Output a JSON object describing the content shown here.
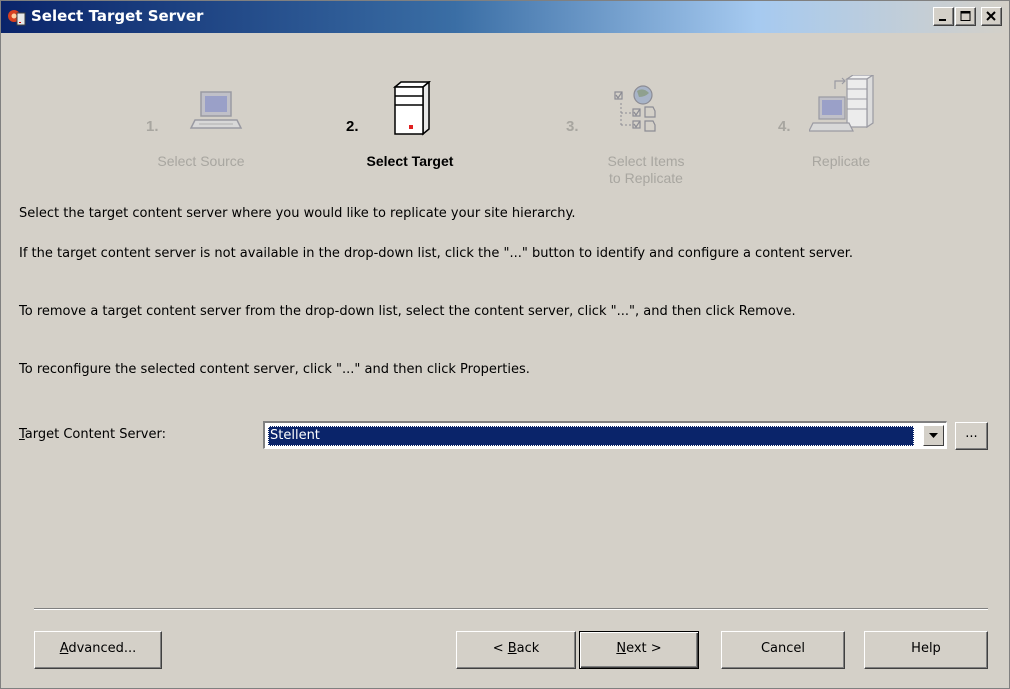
{
  "window": {
    "title": "Select Target Server",
    "controls": {
      "minimize_icon": "minimize-icon",
      "maximize_icon": "maximize-icon",
      "close_icon": "close-icon"
    }
  },
  "steps": [
    {
      "number": "1.",
      "label_line1": "Select Source",
      "label_line2": "",
      "icon": "computer-icon",
      "active": false
    },
    {
      "number": "2.",
      "label_line1": "Select Target",
      "label_line2": "",
      "icon": "server-icon",
      "active": true
    },
    {
      "number": "3.",
      "label_line1": "Select Items",
      "label_line2": "to Replicate",
      "icon": "tree-checklist-icon",
      "active": false
    },
    {
      "number": "4.",
      "label_line1": "Replicate",
      "label_line2": "",
      "icon": "computer-server-replicate-icon",
      "active": false
    }
  ],
  "instructions": [
    "Select the target content server where you would like to replicate your site hierarchy.",
    "If the target content server is not available in the drop-down list, click the \"...\" button to identify and configure a content server.",
    "To remove a target content server from the drop-down list, select the content server, click \"...\", and then click Remove.",
    "To reconfigure the selected content server, click \"...\" and then click Properties."
  ],
  "target_field": {
    "label_mnemonic": "T",
    "label_rest": "arget Content Server:",
    "value": "Stellent",
    "browse_label": "..."
  },
  "buttons": {
    "advanced_mnemonic": "A",
    "advanced_rest": "dvanced...",
    "back_prefix": "< ",
    "back_mnemonic": "B",
    "back_rest": "ack",
    "next_mnemonic": "N",
    "next_rest": "ext >",
    "cancel_label": "Cancel",
    "help_label": "Help"
  },
  "colors": {
    "dialog_bg": "#d4d0c8",
    "titlebar_start": "#0a246a",
    "selection": "#0a246a",
    "disabled_text": "#a8a6a0"
  }
}
